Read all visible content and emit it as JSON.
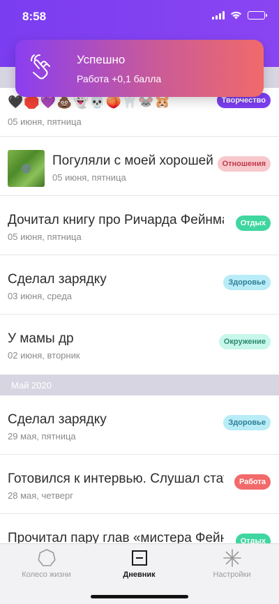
{
  "status_bar": {
    "time": "8:58"
  },
  "toast": {
    "title": "Успешно",
    "text": "Работа +0,1 балла",
    "icon": "hand-tap-icon"
  },
  "entries": [
    {
      "emoji": "🖤🛑💜💩👻💀🍑🦷🐭🐹",
      "date": "05 июня, пятница",
      "tag": "Творчество",
      "tag_bg": "#7b3ff0",
      "tag_fg": "#ffffff"
    },
    {
      "title": "Погуляли с моей хорошей",
      "date": "05 июня, пятница",
      "tag": "Отношения",
      "tag_bg": "#f7c8cc",
      "tag_fg": "#c0394a",
      "has_photo": true
    },
    {
      "title": "Дочитал книгу про Ричарда Фейнмана",
      "date": "05 июня, пятница",
      "tag": "Отдых",
      "tag_bg": "#3fd6a0",
      "tag_fg": "#ffffff"
    },
    {
      "title": "Сделал зарядку",
      "date": "03 июня, среда",
      "tag": "Здоровье",
      "tag_bg": "#b8ecf7",
      "tag_fg": "#2f7e95"
    },
    {
      "title": "У мамы др",
      "date": "02 июня, вторник",
      "tag": "Окружение",
      "tag_bg": "#c7f7ea",
      "tag_fg": "#2c8a6e"
    }
  ],
  "section": {
    "label": "Май 2020"
  },
  "entries_may": [
    {
      "title": "Сделал зарядку",
      "date": "29 мая, пятница",
      "tag": "Здоровье",
      "tag_bg": "#b8ecf7",
      "tag_fg": "#2f7e95"
    },
    {
      "title": "Готовился к интервью. Слушал статьи",
      "date": "28 мая, четверг",
      "tag": "Работа",
      "tag_bg": "#f26a6a",
      "tag_fg": "#ffffff"
    },
    {
      "title": "Прочитал пару глав «мистера Фейнмана»",
      "date": "",
      "tag": "Отдых",
      "tag_bg": "#3fd6a0",
      "tag_fg": "#ffffff"
    }
  ],
  "tabs": [
    {
      "label": "Колесо жизни",
      "icon": "heptagon-icon"
    },
    {
      "label": "Дневник",
      "icon": "diary-icon",
      "active": true
    },
    {
      "label": "Настройки",
      "icon": "asterisk-icon"
    }
  ]
}
